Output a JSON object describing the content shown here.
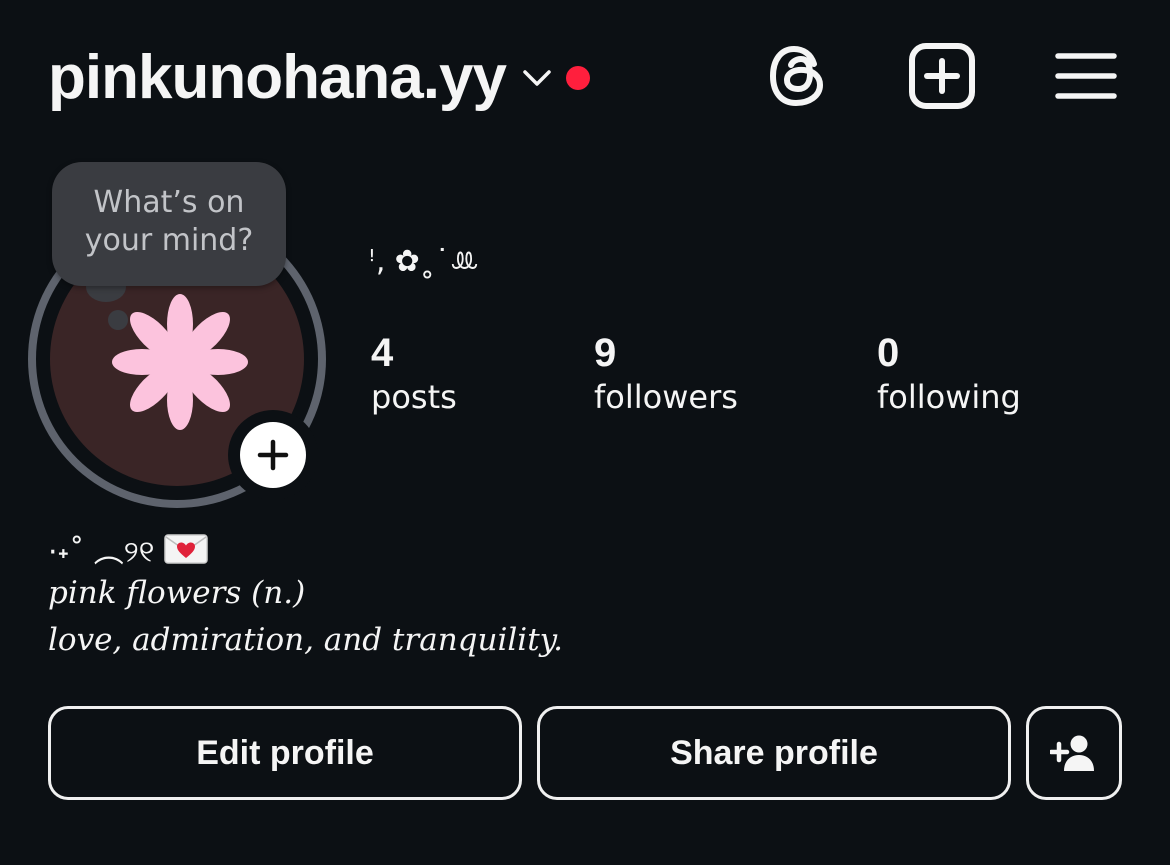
{
  "header": {
    "username": "pinkunohana.yy",
    "notification_dot_color": "#ff1f3d",
    "icons": [
      "chevron-down-icon",
      "threads-icon",
      "create-plus-icon",
      "menu-icon"
    ]
  },
  "note": {
    "text_line1": "What’s on",
    "text_line2": "your mind?"
  },
  "profile": {
    "display_name": "ꜝ‚ ✿˳˙ꔛ",
    "avatar_colors": {
      "background": "#3a2526",
      "flower": "#fcc3dd",
      "ring": "#5e636d"
    }
  },
  "stats": {
    "posts": {
      "count": "4",
      "label": "posts"
    },
    "followers": {
      "count": "9",
      "label": "followers"
    },
    "following": {
      "count": "0",
      "label": "following"
    }
  },
  "bio": {
    "line1": "·˖˚ ︵୨୧",
    "line1_icon": "love-letter-icon",
    "line2": "pink flowers (n.)",
    "line3": "love, admiration, and tranquility."
  },
  "buttons": {
    "edit_profile": "Edit profile",
    "share_profile": "Share profile",
    "add_user_icon": "add-person-icon"
  }
}
